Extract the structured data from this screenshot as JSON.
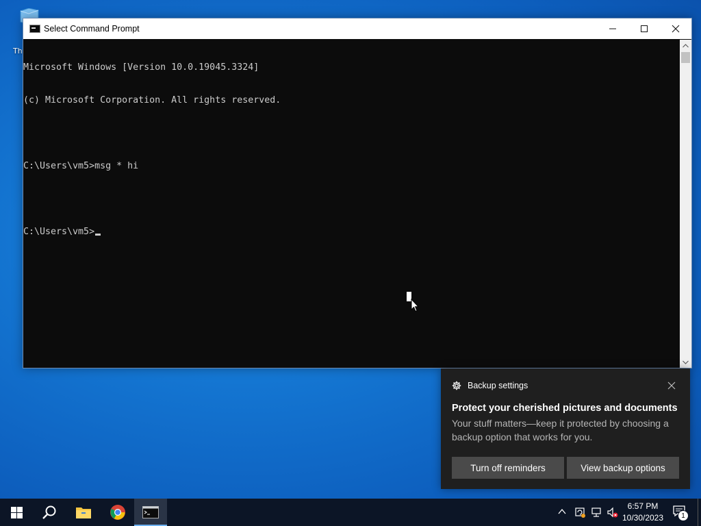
{
  "desktop": {
    "icon_label": "Th",
    "icon_name": "this-pc-icon"
  },
  "window": {
    "title": "Select Command Prompt",
    "icon": "cmd-icon",
    "buttons": {
      "minimize": "minimize-icon",
      "maximize": "maximize-icon",
      "close": "close-icon"
    }
  },
  "console": {
    "lines": [
      "Microsoft Windows [Version 10.0.19045.3324]",
      "(c) Microsoft Corporation. All rights reserved.",
      "",
      "C:\\Users\\vm5>msg * hi",
      "",
      "C:\\Users\\vm5>"
    ]
  },
  "toast": {
    "app_name": "Backup settings",
    "app_icon": "gear-icon",
    "headline": "Protect your cherished pictures and documents",
    "body": "Your stuff matters—keep it protected by choosing a backup option that works for you.",
    "buttons": {
      "dismiss": "Turn off reminders",
      "action": "View backup options"
    }
  },
  "taskbar": {
    "apps": [
      "start-icon",
      "search-icon",
      "file-explorer-icon",
      "chrome-icon",
      "cmd-icon"
    ],
    "clock": {
      "time": "6:57 PM",
      "date": "10/30/2023"
    },
    "notification_count": "1"
  },
  "colors": {
    "console_bg": "#0c0c0c",
    "console_text": "#cccccc",
    "toast_bg": "#1f1f1f",
    "taskbar_bg": "#0c1526",
    "active_indicator": "#6fb3f2"
  }
}
